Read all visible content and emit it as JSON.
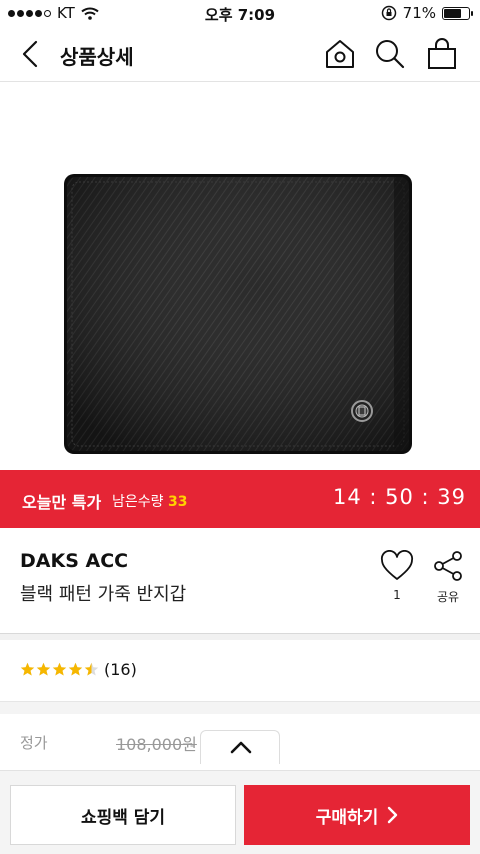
{
  "status_bar": {
    "carrier": "KT",
    "time": "오후 7:09",
    "battery": "71%",
    "battery_level": 0.71,
    "signal_bars_filled": 4,
    "signal_bars_total": 5
  },
  "nav": {
    "title": "상품상세",
    "icons": [
      "back-chevron-icon",
      "home-icon",
      "search-icon",
      "shopping-bag-icon"
    ]
  },
  "product_image": {
    "subject": "black wallet"
  },
  "deal": {
    "label": "오늘만 특가",
    "remaining_label": "남은수량",
    "remaining_count": "33",
    "timer": "14 : 50 : 39",
    "color": "#e52535",
    "count_color": "#ffd200"
  },
  "product": {
    "brand": "DAKS ACC",
    "name": "블랙 패턴 가죽 반지갑",
    "like_count": "1",
    "share_label": "공유"
  },
  "rating": {
    "stars": 4.5,
    "review_count": "(16)",
    "star_color": "#f6b700"
  },
  "price": {
    "label": "정가",
    "original": "108,000원"
  },
  "bottom": {
    "cart_label": "쇼핑백 담기",
    "buy_label": "구매하기"
  }
}
